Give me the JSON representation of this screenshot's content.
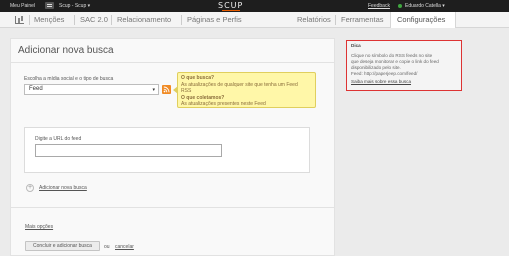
{
  "topbar": {
    "menu_label": "Meu Painel",
    "account": "Scup - Scup",
    "account_caret": "▾",
    "logo": "SCUP",
    "feedback": "Feedback",
    "user": "Eduardo Catella",
    "user_caret": "▾"
  },
  "nav": {
    "left": [
      "Menções",
      "SAC 2.0",
      "Relacionamento",
      "Páginas e Perfis"
    ],
    "right": [
      "Relatórios",
      "Ferramentas",
      "Configurações"
    ],
    "active": "Configurações"
  },
  "main": {
    "title": "Adicionar nova busca",
    "select_label": "Escolha a mídia social e o tipo de busca",
    "select_value": "Feed",
    "select_arrow": "▾",
    "rss_icon": "rss-icon",
    "tip_lines": [
      "O que busca?",
      "As atualizações de qualquer site que tenha um Feed",
      "RSS",
      "O que coletamos?",
      "As atualizações presentes neste Feed"
    ],
    "url_label": "Digite a URL do feed",
    "url_value": "",
    "add_another": "Adicionar nova busca",
    "more_options": "Mais opções",
    "submit": "Concluir e adicionar busca",
    "or": "ou",
    "cancel": "cancelar"
  },
  "sidebar": {
    "title": "Dica",
    "lines": [
      "Clique no símbolo do RSS feeds no site",
      "que deseja monitorar e copie o link do feed",
      "disponibilizado pelo site.",
      "Feed: http://paperjeep.com/feed/"
    ],
    "link": "Saiba mais sobre essa busca"
  },
  "colors": {
    "topbar": "#1e1e1e",
    "accent": "#f08a24",
    "tip_bg": "#fff7a8",
    "highlight_border": "#dd3333"
  }
}
